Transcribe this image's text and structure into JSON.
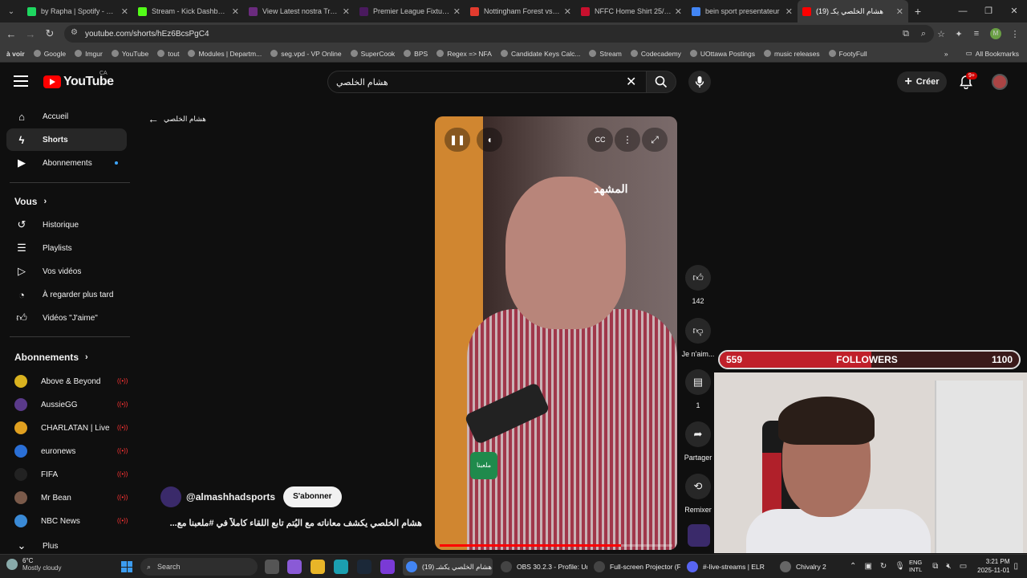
{
  "browser": {
    "tabs": [
      {
        "label": "by Rapha | Spotify - عربي",
        "color": "#1ed760"
      },
      {
        "label": "Stream - Kick Dashboard",
        "color": "#53fc18"
      },
      {
        "label": "View Latest nostra Trabel",
        "color": "#6b2b7e"
      },
      {
        "label": "Premier League Fixtures &",
        "color": "#4a1a5e"
      },
      {
        "label": "Nottingham Forest vs. Ma",
        "color": "#e23b2e"
      },
      {
        "label": "NFFC Home Shirt 25/26",
        "color": "#c8102e"
      },
      {
        "label": "bein sport presentateur",
        "color": "#4285f4"
      },
      {
        "label": "(19) هشام الخلصي يكـ",
        "color": "#ff0000",
        "active": true
      }
    ],
    "url": "youtube.com/shorts/hEz6BcsPgC4",
    "profile_initial": "M",
    "bookmarks": [
      "à voir",
      "Google",
      "Imgur",
      "YouTube",
      "tout",
      "Modules | Departm...",
      "seg.vpd - VP Online",
      "SuperCook",
      "BPS",
      "Regex => NFA",
      "Candidate Keys Calc...",
      "Stream",
      "Codecademy",
      "UOttawa Postings",
      "music releases",
      "FootyFull"
    ],
    "all_bookmarks": "All Bookmarks"
  },
  "youtube": {
    "logo": "YouTube",
    "country": "CA",
    "search_value": "هشام الخلصي",
    "create_label": "Créer",
    "notif_badge": "9+",
    "back_label": "هشام الخلصي",
    "nav": [
      {
        "label": "Accueil",
        "icon": "home-icon"
      },
      {
        "label": "Shorts",
        "icon": "shorts-icon",
        "active": true
      },
      {
        "label": "Abonnements",
        "icon": "subscriptions-icon"
      }
    ],
    "you_header": "Vous",
    "you_items": [
      {
        "label": "Historique",
        "icon": "history-icon"
      },
      {
        "label": "Playlists",
        "icon": "playlists-icon"
      },
      {
        "label": "Vos vidéos",
        "icon": "your-videos-icon"
      },
      {
        "label": "À regarder plus tard",
        "icon": "watch-later-icon"
      },
      {
        "label": "Vidéos \"J'aime\"",
        "icon": "liked-icon"
      }
    ],
    "subs_header": "Abonnements",
    "subscriptions": [
      {
        "label": "Above & Beyond",
        "color": "#d9b21f"
      },
      {
        "label": "AussieGG",
        "color": "#5a3a8a"
      },
      {
        "label": "CHARLATAN | Live",
        "color": "#e0a020"
      },
      {
        "label": "euronews",
        "color": "#2a6fd6"
      },
      {
        "label": "FIFA",
        "color": "#222222"
      },
      {
        "label": "Mr Bean",
        "color": "#7a5a4a"
      },
      {
        "label": "NBC News",
        "color": "#3a8ad6"
      }
    ],
    "more_label": "Plus",
    "video": {
      "overlay_logo": "المشهد",
      "badge": "ملعبنا",
      "progress": 0.78
    },
    "actions": {
      "likes": "142",
      "dislike_label": "Je n'aim...",
      "comments": "1",
      "share_label": "Partager",
      "remix_label": "Remixer"
    },
    "channel_handle": "@almashhadsports",
    "subscribe_label": "S'abonner",
    "caption": "هشام الخلصي يكشف معاناته مع اليُتم تابع اللقاء كاملاً في #ملعبنا مع..."
  },
  "stream_overlay": {
    "followers_current": "559",
    "followers_label": "FOLLOWERS",
    "followers_goal": "1100",
    "followers_fraction": 0.508
  },
  "taskbar": {
    "weather_temp": "6°C",
    "weather_desc": "Mostly cloudy",
    "search_label": "Search",
    "tasks": [
      {
        "label": "هشام الخلصي يكشـ (19)",
        "color": "#4285f4",
        "active": true
      },
      {
        "label": "OBS 30.2.3 - Profile: Ur",
        "color": "#444444"
      },
      {
        "label": "Full-screen Projector (F",
        "color": "#444444"
      },
      {
        "label": "#-live-streams | ELR",
        "color": "#5865f2"
      },
      {
        "label": "Chivalry 2",
        "color": "#666666"
      }
    ],
    "lang_1": "ENG",
    "lang_2": "INTL",
    "time": "3:21 PM",
    "date": "2025-11-01"
  }
}
